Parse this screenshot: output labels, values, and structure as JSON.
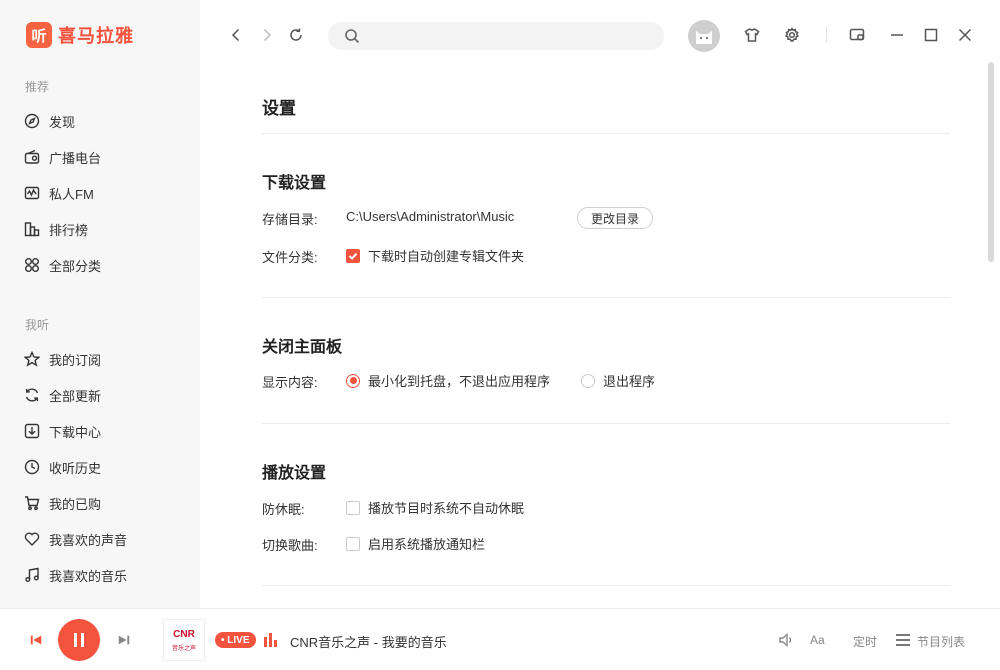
{
  "app": {
    "logo_glyph": "听",
    "logo_text": "喜马拉雅",
    "accent": "#f4533e"
  },
  "sidebar": {
    "section1_title": "推荐",
    "section1_items": [
      {
        "label": "发现",
        "icon": "compass-icon"
      },
      {
        "label": "广播电台",
        "icon": "radio-icon"
      },
      {
        "label": "私人FM",
        "icon": "fm-icon"
      },
      {
        "label": "排行榜",
        "icon": "ranking-icon"
      },
      {
        "label": "全部分类",
        "icon": "category-icon"
      }
    ],
    "section2_title": "我听",
    "section2_items": [
      {
        "label": "我的订阅",
        "icon": "star-icon"
      },
      {
        "label": "全部更新",
        "icon": "refresh-icon"
      },
      {
        "label": "下载中心",
        "icon": "download-icon"
      },
      {
        "label": "收听历史",
        "icon": "clock-icon"
      },
      {
        "label": "我的已购",
        "icon": "cart-icon"
      },
      {
        "label": "我喜欢的声音",
        "icon": "heart-icon"
      },
      {
        "label": "我喜欢的音乐",
        "icon": "music-note-icon"
      }
    ]
  },
  "topbar": {
    "search_placeholder": "",
    "search_value": ""
  },
  "settings": {
    "title": "设置",
    "download": {
      "heading": "下载设置",
      "dir_label": "存储目录:",
      "dir_value": "C:\\Users\\Administrator\\Music",
      "change_button": "更改目录",
      "classify_label": "文件分类:",
      "classify_option": "下载时自动创建专辑文件夹",
      "classify_checked": true
    },
    "close_panel": {
      "heading": "关闭主面板",
      "display_label": "显示内容:",
      "option_minimize": "最小化到托盘，不退出应用程序",
      "option_exit": "退出程序",
      "selected": "minimize"
    },
    "playback": {
      "heading": "播放设置",
      "sleep_label": "防休眠:",
      "sleep_option": "播放节目时系统不自动休眠",
      "sleep_checked": false,
      "switch_label": "切换歌曲:",
      "switch_option": "启用系统播放通知栏",
      "switch_checked": false
    }
  },
  "player": {
    "cover_title": "CNR",
    "cover_subtitle": "音乐之声",
    "live_badge": "• LIVE",
    "track": "CNR音乐之声 - 我要的音乐",
    "timer_label": "定时",
    "playlist_label": "节目列表",
    "font_label": "Aa"
  }
}
